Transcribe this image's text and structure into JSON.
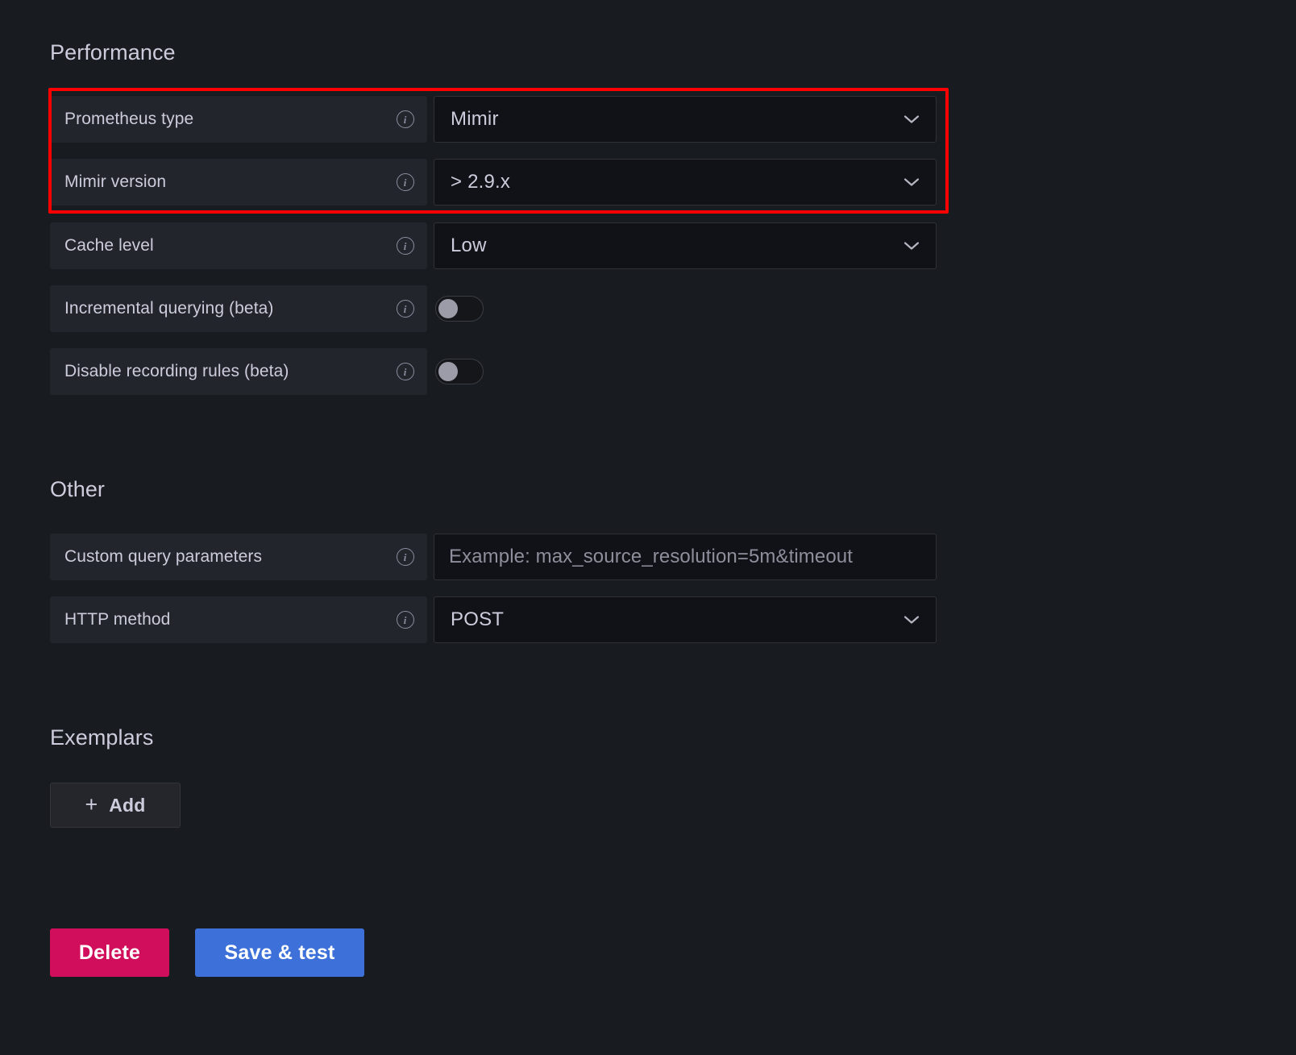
{
  "sections": {
    "performance": {
      "title": "Performance",
      "rows": [
        {
          "label": "Prometheus type",
          "info_icon": "info-circle-icon",
          "control": "select",
          "value": "Mimir",
          "chevron_icon": "chevron-down-icon",
          "highlighted": true
        },
        {
          "label": "Mimir version",
          "info_icon": "info-circle-icon",
          "control": "select",
          "value": "> 2.9.x",
          "chevron_icon": "chevron-down-icon",
          "highlighted": true
        },
        {
          "label": "Cache level",
          "info_icon": "info-circle-icon",
          "control": "select",
          "value": "Low",
          "chevron_icon": "chevron-down-icon",
          "highlighted": false
        },
        {
          "label": "Incremental querying (beta)",
          "info_icon": "info-circle-icon",
          "control": "toggle",
          "value": "off",
          "highlighted": false
        },
        {
          "label": "Disable recording rules (beta)",
          "info_icon": "info-circle-icon",
          "control": "toggle",
          "value": "off",
          "highlighted": false
        }
      ]
    },
    "other": {
      "title": "Other",
      "rows": [
        {
          "label": "Custom query parameters",
          "info_icon": "info-circle-icon",
          "control": "text",
          "value": "",
          "placeholder": "Example: max_source_resolution=5m&timeout"
        },
        {
          "label": "HTTP method",
          "info_icon": "info-circle-icon",
          "control": "select",
          "value": "POST",
          "chevron_icon": "chevron-down-icon"
        }
      ]
    },
    "exemplars": {
      "title": "Exemplars",
      "add_button": {
        "label": "Add",
        "icon": "plus-icon"
      }
    }
  },
  "actions": {
    "delete_label": "Delete",
    "save_label": "Save & test"
  },
  "colors": {
    "page_background": "#181b1f",
    "label_panel": "#22252b",
    "field_background": "#111217",
    "text_primary": "#ccccdc",
    "text_placeholder": "#8e8e9c",
    "highlight_border": "#ff0000",
    "delete_button": "#d10e5c",
    "save_button": "#3d71d9",
    "toggle_knob": "#9b9ca8"
  }
}
